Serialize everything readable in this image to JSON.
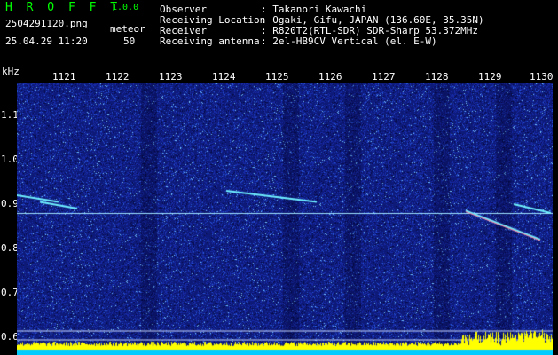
{
  "header": {
    "app_name": "H R O F F T",
    "version": "1.0.0",
    "file_name": "2504291120.png",
    "date_time": "25.04.29 11:20",
    "meteor_label": "meteor",
    "meteor_count": "50"
  },
  "info": [
    {
      "key": "Observer",
      "value": ": Takanori Kawachi"
    },
    {
      "key": "Receiving Location",
      "value": ": Ogaki, Gifu, JAPAN (136.60E, 35.35N)"
    },
    {
      "key": "Receiver",
      "value": ": R820T2(RTL-SDR) SDR-Sharp 53.372MHz"
    },
    {
      "key": "Receiving antenna",
      "value": ": 2el-HB9CV Vertical (el. E-W)"
    }
  ],
  "axes": {
    "unit": "kHz",
    "time_ticks": [
      "1121",
      "1122",
      "1123",
      "1124",
      "1125",
      "1126",
      "1127",
      "1128",
      "1129",
      "1130"
    ],
    "freq_ticks": [
      "1.1",
      "1.0",
      "0.9",
      "0.8",
      "0.7",
      "0.6"
    ]
  },
  "spectrogram": {
    "time_range_min": [
      1120,
      1130
    ],
    "freq_range_khz": [
      0.58,
      1.18
    ],
    "carrier_khz": 0.88,
    "reference_lines_khz": [
      0.615,
      0.595
    ],
    "colors": {
      "noise": "#1a2fa8",
      "carrier": "#9fe3ff",
      "echo": "#6ff0ff",
      "baseline": "#ffff00",
      "baseline_base": "#00ccff"
    },
    "meteor_echoes": [
      {
        "t": [
          1120.0,
          1121.05
        ],
        "f": [
          0.925,
          0.905
        ]
      },
      {
        "t": [
          1120.7,
          1121.4
        ],
        "f": [
          0.905,
          0.89
        ]
      },
      {
        "t": [
          1124.2,
          1125.9
        ],
        "f": [
          0.93,
          0.905
        ]
      },
      {
        "t": [
          1128.7,
          1130.1
        ],
        "f": [
          0.885,
          0.82
        ]
      },
      {
        "t": [
          1129.6,
          1130.3
        ],
        "f": [
          0.9,
          0.88
        ]
      }
    ]
  }
}
